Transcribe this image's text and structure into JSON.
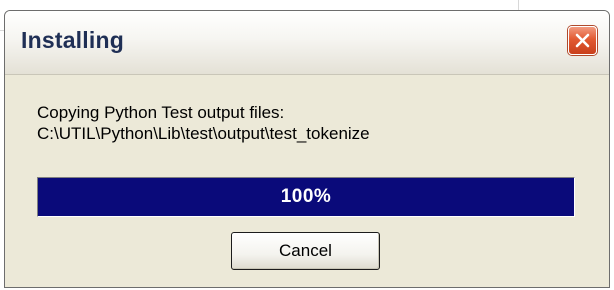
{
  "window": {
    "title": "Installing",
    "close_icon": "close-x-icon",
    "colors": {
      "title_text": "#1f2f55",
      "dialog_bg": "#ece9d8",
      "close_button": "#e25a32"
    }
  },
  "message": {
    "line1": "Copying Python Test output files:",
    "line2": "C:\\UTIL\\Python\\Lib\\test\\output\\test_tokenize"
  },
  "progress": {
    "value": 1.0,
    "label": "100%",
    "bar_color": "#0a0a7a"
  },
  "buttons": {
    "cancel_label": "Cancel"
  }
}
